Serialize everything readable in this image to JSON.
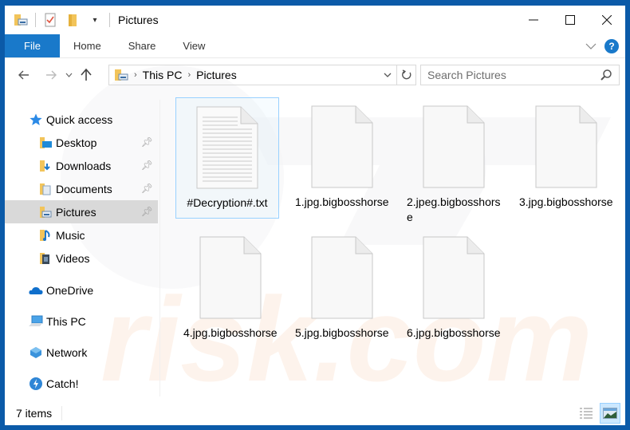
{
  "window": {
    "title": "Pictures",
    "controls": {
      "minimize": "–",
      "maximize": "☐",
      "close": "✕"
    }
  },
  "quick_access_toolbar": {
    "icons": [
      "properties-icon",
      "new-folder-icon",
      "customize-dropdown-icon"
    ]
  },
  "ribbon": {
    "tabs": [
      {
        "label": "File",
        "active": true
      },
      {
        "label": "Home"
      },
      {
        "label": "Share"
      },
      {
        "label": "View"
      }
    ],
    "help_label": "?"
  },
  "address_bar": {
    "breadcrumb": [
      "This PC",
      "Pictures"
    ],
    "search_placeholder": "Search Pictures"
  },
  "sidebar": {
    "quick_access_label": "Quick access",
    "items": [
      {
        "label": "Desktop",
        "icon": "desktop-folder-icon",
        "pinned": true
      },
      {
        "label": "Downloads",
        "icon": "downloads-folder-icon",
        "pinned": true
      },
      {
        "label": "Documents",
        "icon": "documents-folder-icon",
        "pinned": true
      },
      {
        "label": "Pictures",
        "icon": "pictures-folder-icon",
        "pinned": true,
        "selected": true
      },
      {
        "label": "Music",
        "icon": "music-folder-icon",
        "pinned": false
      },
      {
        "label": "Videos",
        "icon": "videos-folder-icon",
        "pinned": false
      }
    ],
    "locations": [
      {
        "label": "OneDrive",
        "icon": "onedrive-icon"
      },
      {
        "label": "This PC",
        "icon": "this-pc-icon"
      },
      {
        "label": "Network",
        "icon": "network-icon"
      },
      {
        "label": "Catch!",
        "icon": "catch-icon"
      }
    ]
  },
  "files": [
    {
      "name": "#Decryption#.txt",
      "type": "text",
      "selected": true
    },
    {
      "name": "1.jpg.bigbosshorse",
      "type": "blank"
    },
    {
      "name": "2.jpeg.bigbosshorse",
      "type": "blank"
    },
    {
      "name": "3.jpg.bigbosshorse",
      "type": "blank"
    },
    {
      "name": "4.jpg.bigbosshorse",
      "type": "blank"
    },
    {
      "name": "5.jpg.bigbosshorse",
      "type": "blank"
    },
    {
      "name": "6.jpg.bigbosshorse",
      "type": "blank"
    }
  ],
  "status_bar": {
    "item_count": "7 items",
    "view_modes": [
      "details-view",
      "large-icons-view"
    ],
    "active_view": "large-icons-view"
  },
  "colors": {
    "accent": "#1979ca",
    "window_border": "#0b5aa8",
    "selection": "#cce8ff",
    "selection_border": "#99d1ff",
    "sidebar_selected": "#d9d9d9"
  }
}
